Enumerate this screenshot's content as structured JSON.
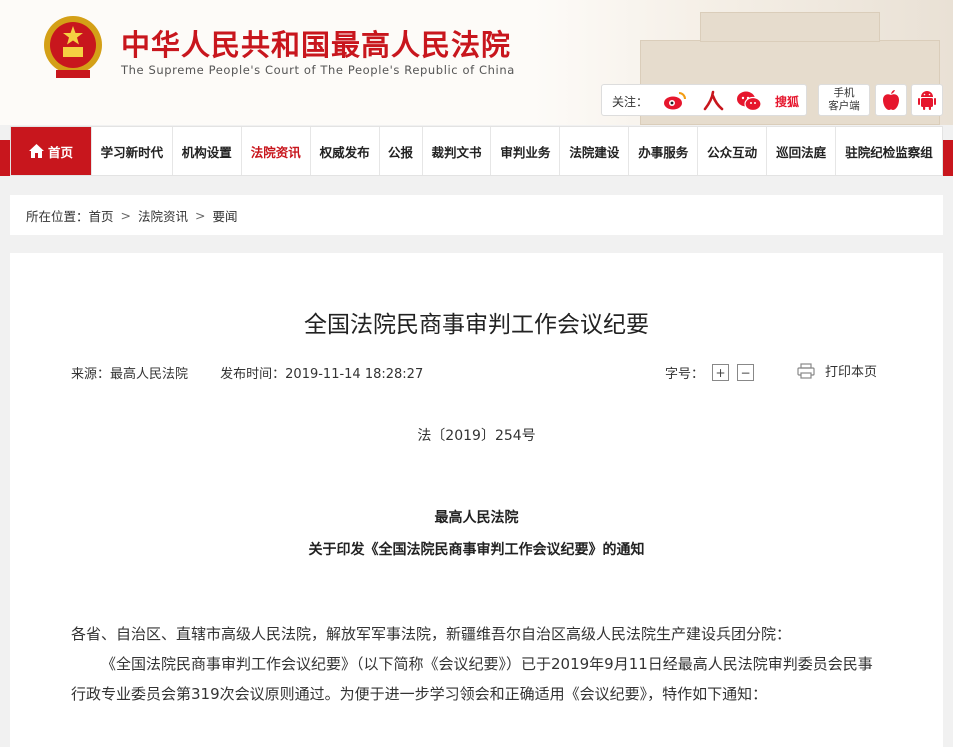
{
  "header": {
    "title_cn": "中华人民共和国最高人民法院",
    "title_en": "The Supreme People's Court of The People's Republic of China",
    "follow_label": "关注：",
    "follow_icons": [
      "weibo-icon",
      "renmin-icon",
      "wechat-icon",
      "sohu-icon"
    ],
    "sohu_text": "搜狐",
    "client_label_line1": "手机",
    "client_label_line2": "客户端",
    "app_icons": [
      "apple-icon",
      "android-icon"
    ],
    "brand_red": "#c8161d"
  },
  "nav": {
    "items": [
      {
        "label": "首页"
      },
      {
        "label": "学习新时代"
      },
      {
        "label": "机构设置"
      },
      {
        "label": "法院资讯"
      },
      {
        "label": "权威发布"
      },
      {
        "label": "公报"
      },
      {
        "label": "裁判文书"
      },
      {
        "label": "审判业务"
      },
      {
        "label": "法院建设"
      },
      {
        "label": "办事服务"
      },
      {
        "label": "公众互动"
      },
      {
        "label": "巡回法庭"
      },
      {
        "label": "驻院纪检监察组"
      }
    ],
    "active": "法院资讯"
  },
  "breadcrumb": {
    "prefix": "所在位置：",
    "items": [
      "首页",
      "法院资讯",
      "要闻"
    ],
    "separator": ">"
  },
  "article": {
    "title": "全国法院民商事审判工作会议纪要",
    "source": "来源：最高人民法院",
    "publish_time": "发布时间：2019-11-14 18:28:27",
    "font_size_label": "字号：",
    "font_increase": "+",
    "font_decrease": "−",
    "print_label": "打印本页",
    "doc_number": "法〔2019〕254号",
    "issuer": "最高人民法院",
    "subtitle": "关于印发《全国法院民商事审判工作会议纪要》的通知",
    "paragraphs": [
      "各省、自治区、直辖市高级人民法院，解放军军事法院，新疆维吾尔自治区高级人民法院生产建设兵团分院：",
      "《全国法院民商事审判工作会议纪要》（以下简称《会议纪要》）已于2019年9月11日经最高人民法院审判委员会民事行政专业委员会第319次会议原则通过。为便于进一步学习领会和正确适用《会议纪要》，特作如下通知："
    ]
  }
}
